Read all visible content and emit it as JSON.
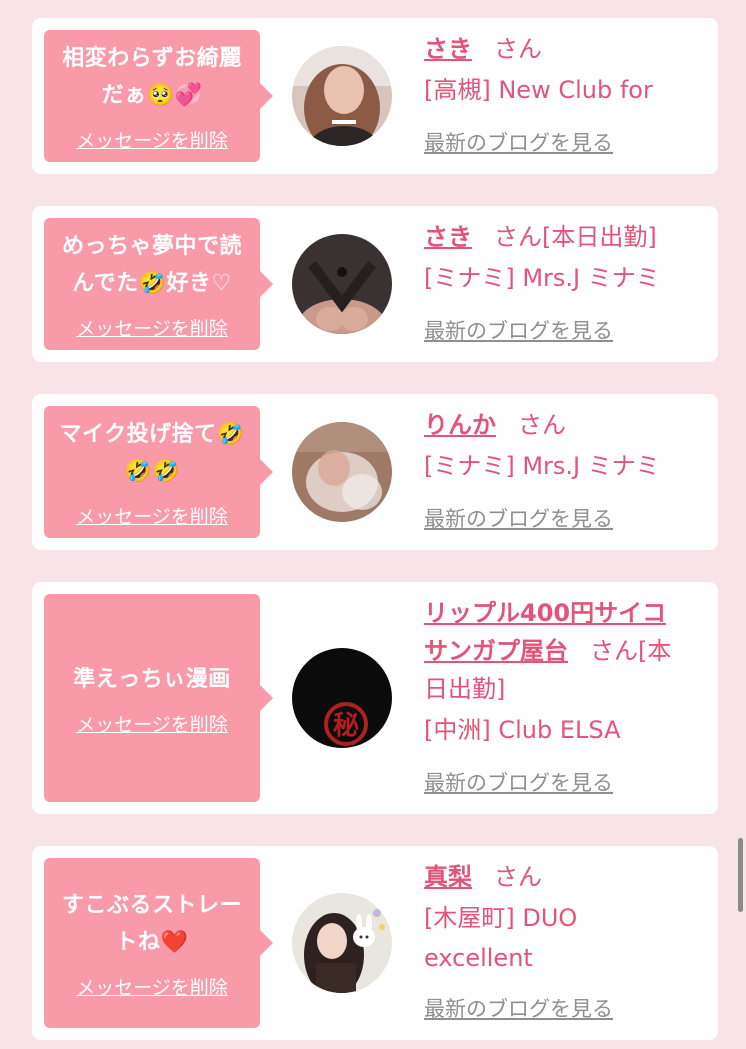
{
  "delete_label": "メッセージを削除",
  "blog_label": "最新のブログを見る",
  "san_suffix": "さん",
  "cards": [
    {
      "message_line1": "相変わらずお綺麗",
      "message_line2": "だぁ🥺💞",
      "name": "さき",
      "status": "",
      "store": "[高槻] New Club for"
    },
    {
      "message_line1": "めっちゃ夢中で読",
      "message_line2": "んでた🤣好き♡",
      "name": "さき",
      "status": "[本日出勤]",
      "store": "[ミナミ] Mrs.J ミナミ"
    },
    {
      "message_line1": "マイク投げ捨て🤣",
      "message_line2": "🤣🤣",
      "name": "りんか",
      "status": "",
      "store": "[ミナミ] Mrs.J ミナミ"
    },
    {
      "message_line1": "準えっちぃ漫画",
      "name_line1": "リップル400円サイコ",
      "name_line2": "サンガプ屋台",
      "status_line1": "[本",
      "status_line2": "日出勤]",
      "store": "[中洲] Club ELSA",
      "avatar_glyph": "秘"
    },
    {
      "message_line1": "すこぶるストレー",
      "message_line2": "トね❤️",
      "name": "真梨",
      "status": "",
      "store_line1": "[木屋町] DUO",
      "store_line2": "excellent"
    }
  ]
}
